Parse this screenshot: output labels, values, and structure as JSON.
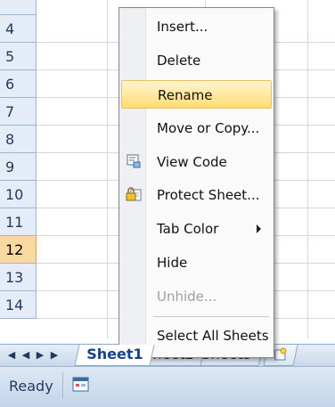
{
  "rows": [
    "4",
    "5",
    "6",
    "7",
    "8",
    "9",
    "10",
    "11",
    "12",
    "13",
    "14"
  ],
  "selected_row": "12",
  "context_menu": {
    "items": [
      {
        "label": "Insert...",
        "icon": "",
        "enabled": true,
        "highlighted": false,
        "submenu": false
      },
      {
        "label": "Delete",
        "icon": "",
        "enabled": true,
        "highlighted": false,
        "submenu": false
      },
      {
        "label": "Rename",
        "icon": "",
        "enabled": true,
        "highlighted": true,
        "submenu": false
      },
      {
        "label": "Move or Copy...",
        "icon": "",
        "enabled": true,
        "highlighted": false,
        "submenu": false
      },
      {
        "label": "View Code",
        "icon": "view-code-icon",
        "enabled": true,
        "highlighted": false,
        "submenu": false
      },
      {
        "label": "Protect Sheet...",
        "icon": "protect-sheet-icon",
        "enabled": true,
        "highlighted": false,
        "submenu": false
      },
      {
        "label": "Tab Color",
        "icon": "",
        "enabled": true,
        "highlighted": false,
        "submenu": true
      },
      {
        "label": "Hide",
        "icon": "",
        "enabled": true,
        "highlighted": false,
        "submenu": false
      },
      {
        "label": "Unhide...",
        "icon": "",
        "enabled": false,
        "highlighted": false,
        "submenu": false
      },
      {
        "label": "Select All Sheets",
        "icon": "",
        "enabled": true,
        "highlighted": false,
        "submenu": false
      }
    ]
  },
  "sheet_tabs": [
    {
      "label": "Sheet1",
      "active": true
    },
    {
      "label": "Sheet2",
      "active": false
    },
    {
      "label": "Sheet3",
      "active": false
    }
  ],
  "insert_sheet_icon": "insert-worksheet-icon",
  "status": {
    "text": "Ready",
    "icon": "macro-record-icon"
  },
  "colors": {
    "menu_highlight": "#ffdb73",
    "row_header": "#e4ecf7",
    "selected_row_header": "#f9d99f",
    "status_bar": "#c4d5ea"
  }
}
